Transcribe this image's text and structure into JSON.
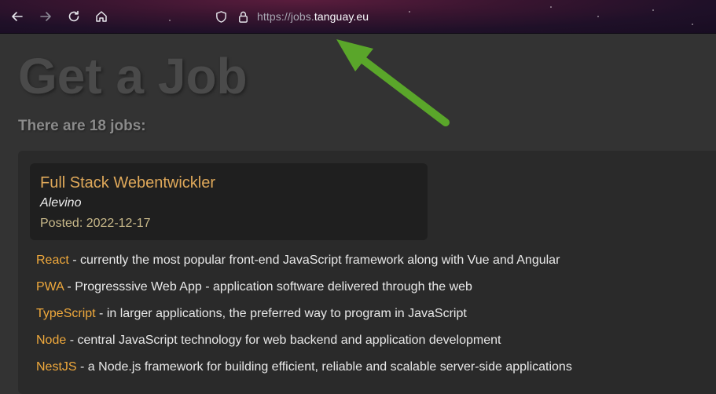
{
  "browser": {
    "url_scheme": "https://",
    "url_host_prefix": "jobs.",
    "url_host": "tanguay.eu",
    "nav_icons": [
      "back-icon",
      "forward-icon",
      "reload-icon",
      "home-icon"
    ],
    "security_icons": [
      "tracking-protection-shield-icon",
      "lock-icon"
    ]
  },
  "page": {
    "title": "Get a Job",
    "job_count_text": "There are 18 jobs:"
  },
  "job": {
    "title": "Full Stack Webentwickler",
    "company": "Alevino",
    "posted_label": "Posted:",
    "posted_date": "2022-12-17"
  },
  "skills": [
    {
      "name": "React",
      "description": " - currently the most popular front-end JavaScript framework along with Vue and Angular"
    },
    {
      "name": "PWA",
      "description": " - Progresssive Web App - application software delivered through the web"
    },
    {
      "name": "TypeScript",
      "description": " - in larger applications, the preferred way to program in JavaScript"
    },
    {
      "name": "Node",
      "description": " - central JavaScript technology for web backend and application development"
    },
    {
      "name": "NestJS",
      "description": " - a Node.js framework for building efficient, reliable and scalable server-side applications"
    }
  ],
  "colors": {
    "accent": "#f0a93c",
    "job_title": "#e0a95a",
    "annotation_arrow": "#5aa62a",
    "page_background": "#333333"
  }
}
